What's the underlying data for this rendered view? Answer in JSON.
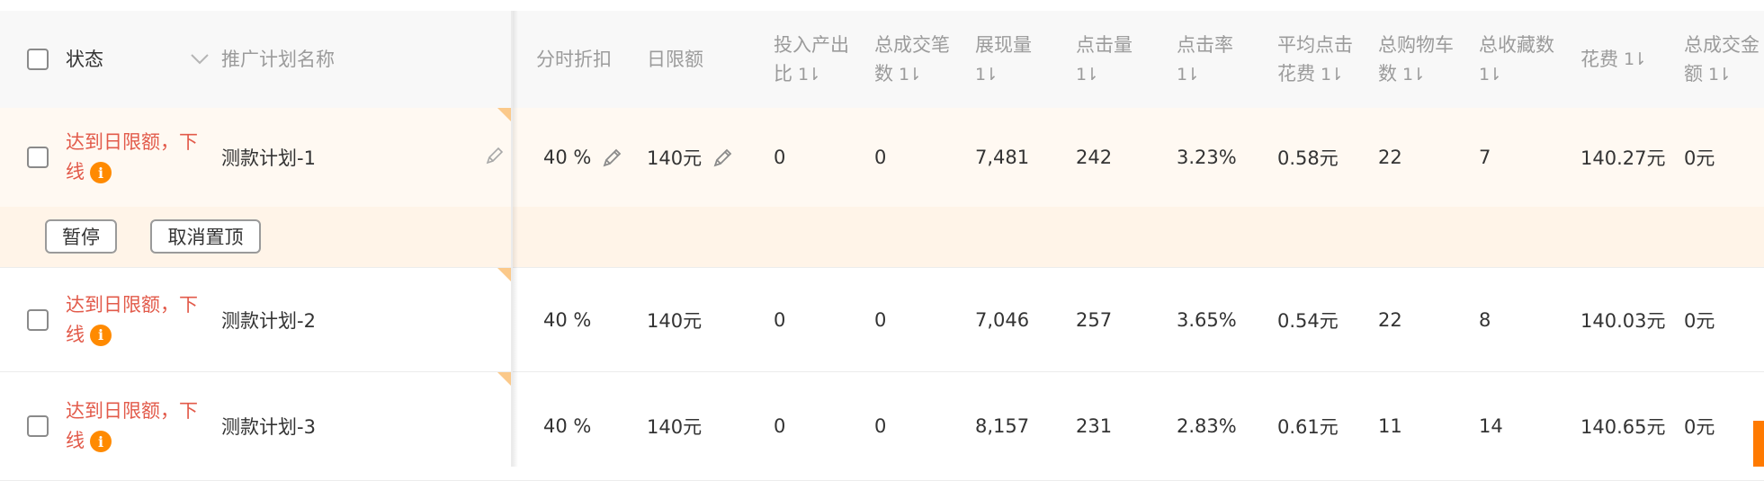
{
  "header": {
    "status": "状态",
    "name": "推广计划名称",
    "columns": [
      {
        "l1": "分时折扣",
        "l2": "",
        "sortable": false
      },
      {
        "l1": "日限额",
        "l2": "",
        "sortable": false
      },
      {
        "l1": "投入产出",
        "l2": "比",
        "sortable": true
      },
      {
        "l1": "总成交笔",
        "l2": "数",
        "sortable": true
      },
      {
        "l1": "展现量",
        "l2": "",
        "sortable": true
      },
      {
        "l1": "点击量",
        "l2": "",
        "sortable": true
      },
      {
        "l1": "点击率",
        "l2": "",
        "sortable": true
      },
      {
        "l1": "平均点击",
        "l2": "花费",
        "sortable": true
      },
      {
        "l1": "总购物车",
        "l2": "数",
        "sortable": true
      },
      {
        "l1": "总收藏数",
        "l2": "",
        "sortable": true
      },
      {
        "l1": "花费",
        "l2": "",
        "sortable": true
      },
      {
        "l1": "总成交金",
        "l2": "额",
        "sortable": true
      }
    ],
    "sort_glyph": "1⇂"
  },
  "rows": [
    {
      "status_line1": "达到日限额，下",
      "status_line2": "线",
      "name": "测款计划-1",
      "discount": "40 %",
      "daily_limit": "140元",
      "roi": "0",
      "orders": "0",
      "impressions": "7,481",
      "clicks": "242",
      "ctr": "3.23%",
      "cpc": "0.58元",
      "carts": "22",
      "favorites": "7",
      "cost": "140.27元",
      "gmv": "0元"
    },
    {
      "status_line1": "达到日限额，下",
      "status_line2": "线",
      "name": "测款计划-2",
      "discount": "40 %",
      "daily_limit": "140元",
      "roi": "0",
      "orders": "0",
      "impressions": "7,046",
      "clicks": "257",
      "ctr": "3.65%",
      "cpc": "0.54元",
      "carts": "22",
      "favorites": "8",
      "cost": "140.03元",
      "gmv": "0元"
    },
    {
      "status_line1": "达到日限额，下",
      "status_line2": "线",
      "name": "测款计划-3",
      "discount": "40 %",
      "daily_limit": "140元",
      "roi": "0",
      "orders": "0",
      "impressions": "8,157",
      "clicks": "231",
      "ctr": "2.83%",
      "cpc": "0.61元",
      "carts": "11",
      "favorites": "14",
      "cost": "140.65元",
      "gmv": "0元"
    }
  ],
  "actions": {
    "pause": "暂停",
    "unpin": "取消置顶"
  },
  "icons": {
    "info": "i"
  },
  "colors": {
    "status_red": "#e25a4a",
    "accent_orange": "#ff8a00"
  }
}
